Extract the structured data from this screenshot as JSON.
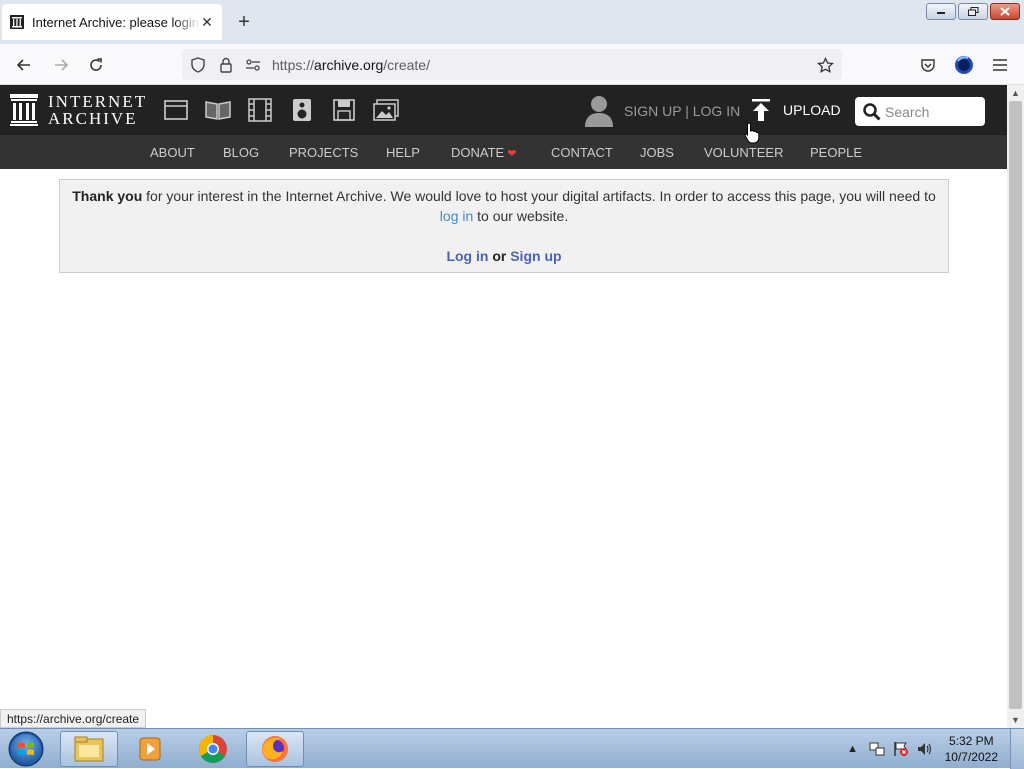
{
  "browser": {
    "tab_title": "Internet Archive: please login or sign up",
    "new_tab_symbol": "+",
    "url_scheme": "https://",
    "url_host": "archive.org",
    "url_path": "/create/",
    "status_url": "https://archive.org/create"
  },
  "site": {
    "logo_line1": "INTERNET",
    "logo_line2": "ARCHIVE",
    "user_links": {
      "sign_up": "SIGN UP",
      "separator": " | ",
      "log_in": "LOG IN"
    },
    "upload_label": "UPLOAD",
    "search_placeholder": "Search",
    "nav": [
      {
        "label": "ABOUT"
      },
      {
        "label": "BLOG"
      },
      {
        "label": "PROJECTS"
      },
      {
        "label": "HELP"
      },
      {
        "label": "DONATE"
      },
      {
        "label": "CONTACT"
      },
      {
        "label": "JOBS"
      },
      {
        "label": "VOLUNTEER"
      },
      {
        "label": "PEOPLE"
      }
    ]
  },
  "notice": {
    "bold_lead": "Thank you",
    "text_part1": " for your interest in the Internet Archive. We would love to host your digital artifacts. In order to access this page, you will need to ",
    "link_text": "log in",
    "text_part2": " to our website.",
    "login_label": "Log in",
    "or_label": " or ",
    "signup_label": "Sign up"
  },
  "taskbar": {
    "time": "5:32 PM",
    "date": "10/7/2022"
  },
  "colors": {
    "header_bg": "#222222",
    "nav_bg": "#333333",
    "link": "#428bca",
    "heart": "#e53c3c"
  }
}
